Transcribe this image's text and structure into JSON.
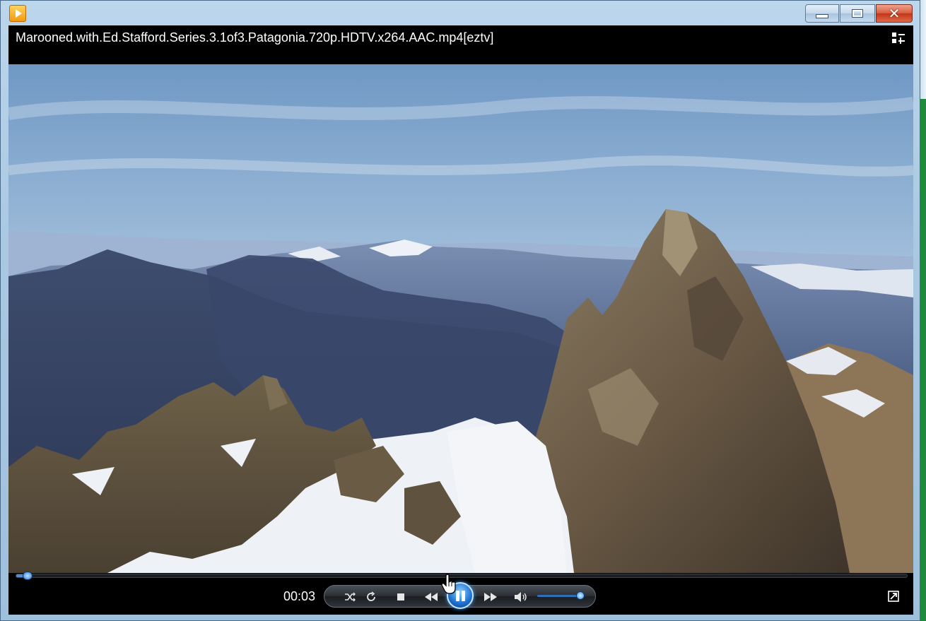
{
  "window": {
    "title": "Marooned.with.Ed.Stafford.Series.3.1of3.Patagonia.720p.HDTV.x264.AAC.mp4[eztv]"
  },
  "icons": {
    "app": "media-player-icon",
    "minimize": "minimize-icon",
    "maximize": "maximize-icon",
    "close": "close-icon",
    "switch_view": "switch-to-library-icon",
    "shuffle": "shuffle-icon",
    "repeat": "repeat-icon",
    "stop": "stop-icon",
    "previous": "rewind-icon",
    "pause": "pause-icon",
    "next": "fast-forward-icon",
    "volume": "speaker-icon",
    "fullscreen": "fullscreen-icon"
  },
  "playback": {
    "time": "00:03",
    "progress": 0.01,
    "volume": 0.95,
    "state": "playing"
  },
  "colors": {
    "accent": "#2d7bd3",
    "close_button": "#d85a3c",
    "player_bg": "#000000"
  }
}
